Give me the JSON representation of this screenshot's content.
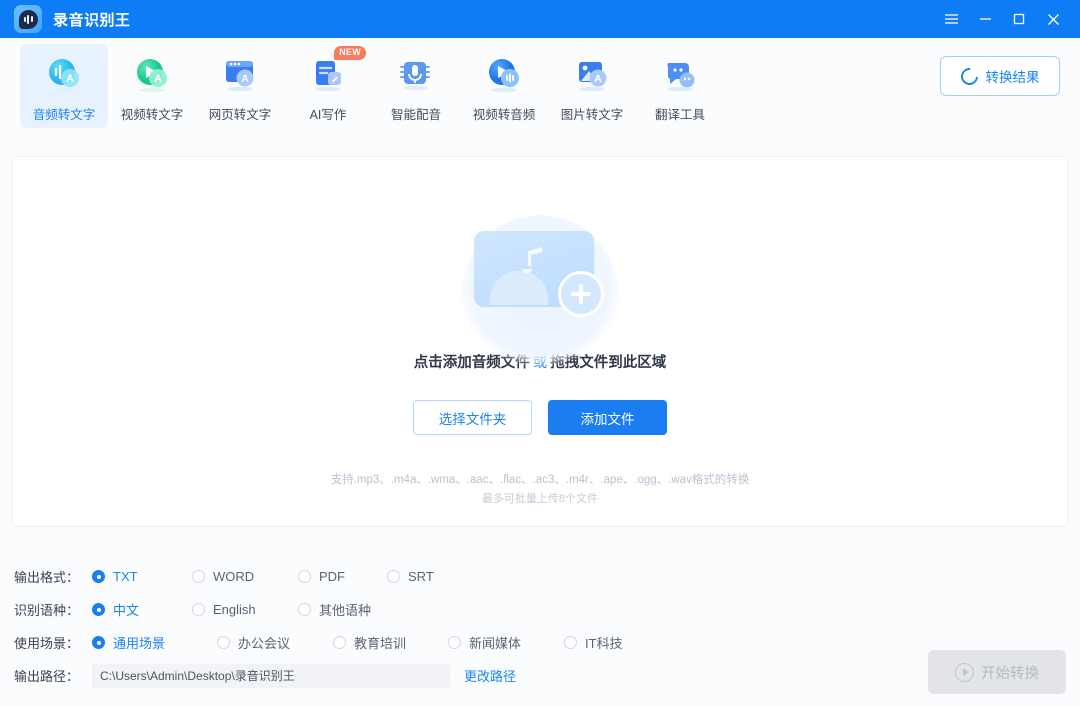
{
  "titlebar": {
    "app_title": "录音识别王",
    "logo_icon": "sound-bubble-icon",
    "menu_icon": "hamburger-menu-icon",
    "minimize_icon": "minimize-icon",
    "maximize_icon": "maximize-icon",
    "close_icon": "close-icon"
  },
  "tabs": [
    {
      "label": "音频转文字",
      "icon": "audio-to-text-icon",
      "active": true,
      "badge": ""
    },
    {
      "label": "视频转文字",
      "icon": "video-to-text-icon",
      "active": false,
      "badge": ""
    },
    {
      "label": "网页转文字",
      "icon": "web-to-text-icon",
      "active": false,
      "badge": ""
    },
    {
      "label": "AI写作",
      "icon": "ai-writing-icon",
      "active": false,
      "badge": "NEW"
    },
    {
      "label": "智能配音",
      "icon": "smart-dubbing-icon",
      "active": false,
      "badge": ""
    },
    {
      "label": "视频转音频",
      "icon": "video-to-audio-icon",
      "active": false,
      "badge": ""
    },
    {
      "label": "图片转文字",
      "icon": "image-to-text-icon",
      "active": false,
      "badge": ""
    },
    {
      "label": "翻译工具",
      "icon": "translate-icon",
      "active": false,
      "badge": ""
    }
  ],
  "toolbar": {
    "result_button": "转换结果",
    "result_icon": "refresh-circle-icon"
  },
  "dropzone": {
    "icon": "audio-file-add-icon",
    "hint_prefix": "点击添加音频文件",
    "hint_or": "或",
    "hint_suffix": "拖拽文件到此区域",
    "select_folder_button": "选择文件夹",
    "add_file_button": "添加文件",
    "formats_line": "支持.mp3、.m4a、.wma、.aac、.flac、.ac3、.m4r、.ape、.ogg、.wav格式的转换",
    "limit_line": "最多可批量上传8个文件"
  },
  "options": {
    "output_format": {
      "label": "输出格式：",
      "selected": "TXT",
      "items": [
        "TXT",
        "WORD",
        "PDF",
        "SRT"
      ]
    },
    "language": {
      "label": "识别语种：",
      "selected": "中文",
      "items": [
        "中文",
        "English",
        "其他语种"
      ]
    },
    "scene": {
      "label": "使用场景：",
      "selected": "通用场景",
      "items": [
        "通用场景",
        "办公会议",
        "教育培训",
        "新闻媒体",
        "IT科技"
      ]
    },
    "output_path": {
      "label": "输出路径：",
      "value": "C:\\Users\\Admin\\Desktop\\录音识别王",
      "placeholder": "C:\\Users\\Admin\\Desktop\\录音识别王",
      "change_link": "更改路径"
    }
  },
  "footer": {
    "start_button": "开始转换",
    "start_icon": "play-circle-icon"
  },
  "colors": {
    "brand_blue": "#0d7cf5",
    "accent_blue": "#1a84f5",
    "badge_orange": "#fa7a5e",
    "panel_white": "#ffffff",
    "page_bg": "#fbfcfe"
  }
}
